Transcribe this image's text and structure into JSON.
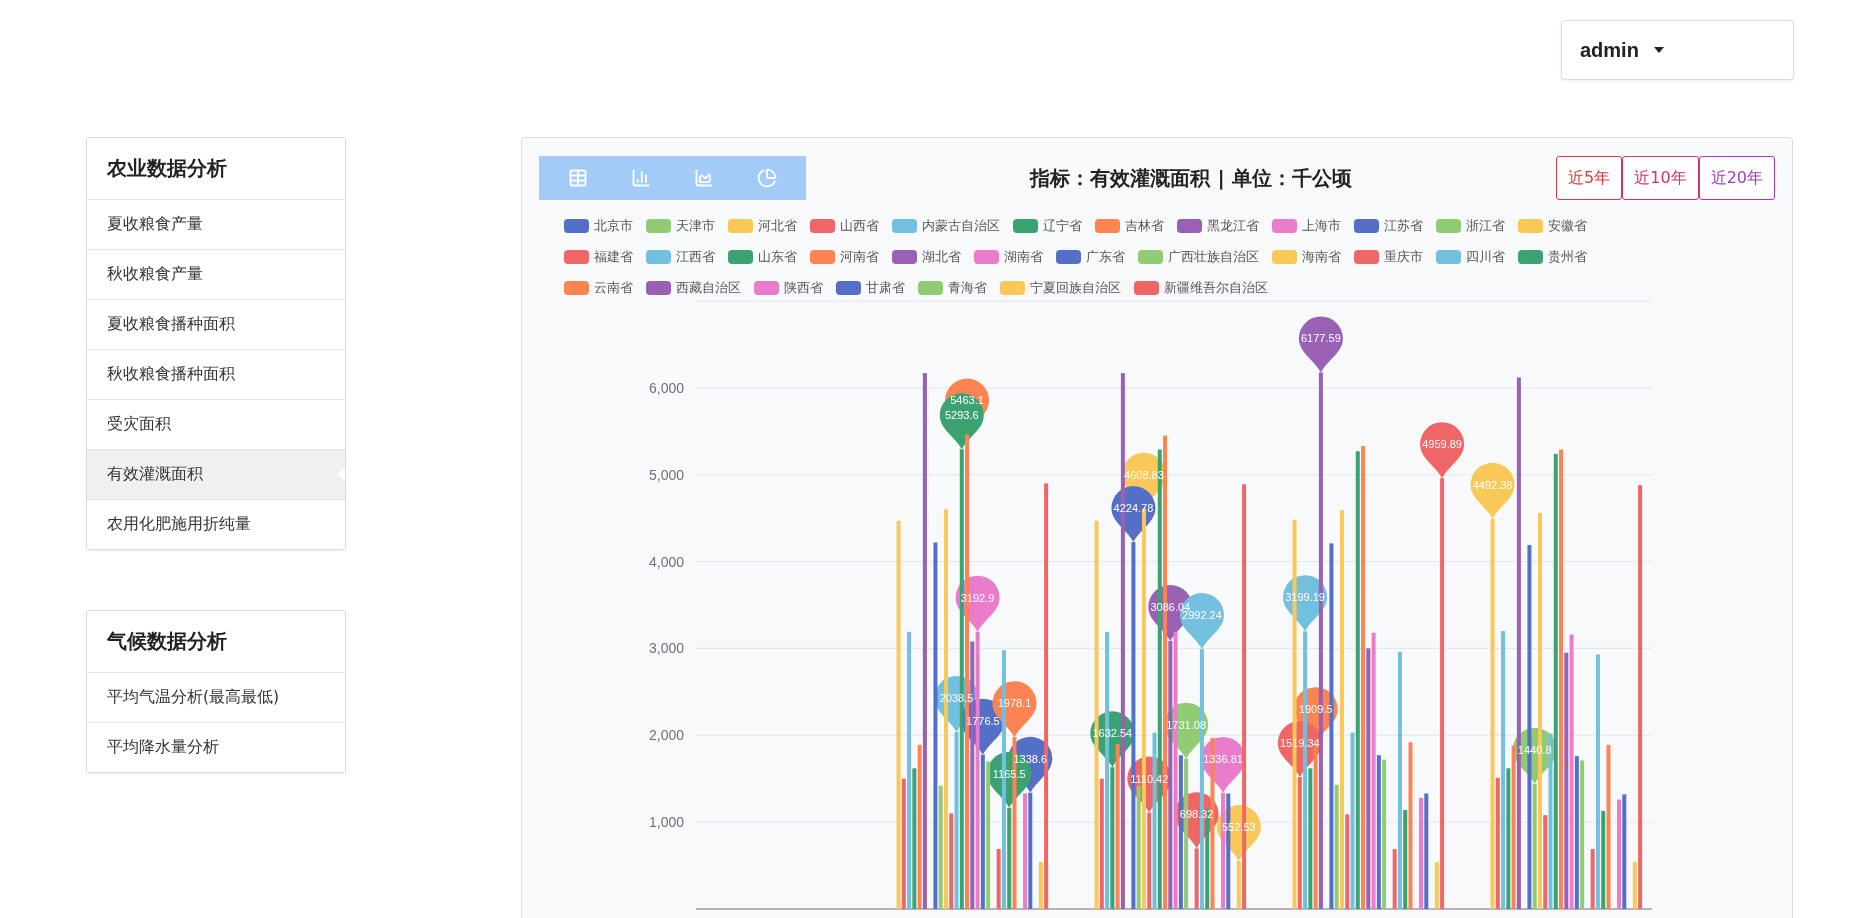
{
  "user_menu": {
    "label": "admin"
  },
  "sidebar": {
    "sections": [
      {
        "title": "农业数据分析",
        "items": [
          {
            "label": "夏收粮食产量",
            "selected": false
          },
          {
            "label": "秋收粮食产量",
            "selected": false
          },
          {
            "label": "夏收粮食播种面积",
            "selected": false
          },
          {
            "label": "秋收粮食播种面积",
            "selected": false
          },
          {
            "label": "受灾面积",
            "selected": false
          },
          {
            "label": "有效灌溉面积",
            "selected": true
          },
          {
            "label": "农用化肥施用折纯量",
            "selected": false
          }
        ]
      },
      {
        "title": "气候数据分析",
        "items": [
          {
            "label": "平均气温分析(最高最低)",
            "selected": false
          },
          {
            "label": "平均降水量分析",
            "selected": false
          }
        ]
      }
    ]
  },
  "range_buttons": [
    {
      "label": "近5年",
      "color": "#e0383e"
    },
    {
      "label": "近10年",
      "color": "#d8306a"
    },
    {
      "label": "近20年",
      "color": "#a33bc0"
    }
  ],
  "chart_data": {
    "type": "bar",
    "title": "指标：有效灌溉面积 | 单位：千公顷",
    "grid": true,
    "stacked": false,
    "ylim": [
      0,
      7000
    ],
    "yticks": [
      {
        "value": 1000,
        "label": "1,000"
      },
      {
        "value": 2000,
        "label": "2,000"
      },
      {
        "value": 3000,
        "label": "3,000"
      },
      {
        "value": 4000,
        "label": "4,000"
      },
      {
        "value": 5000,
        "label": "5,000"
      },
      {
        "value": 6000,
        "label": "6,000"
      }
    ],
    "series": [
      {
        "name": "北京市",
        "color": "#5470c6",
        "values": [
          null,
          null,
          null,
          null,
          null
        ]
      },
      {
        "name": "天津市",
        "color": "#91cc75",
        "values": [
          null,
          null,
          null,
          null,
          null
        ]
      },
      {
        "name": "河北省",
        "color": "#fac858",
        "values": [
          null,
          4470,
          4470,
          4480,
          4492.38
        ]
      },
      {
        "name": "山西省",
        "color": "#ee6666",
        "values": [
          null,
          1500,
          1500,
          1519.34,
          1510
        ]
      },
      {
        "name": "内蒙古自治区",
        "color": "#73c0de",
        "values": [
          null,
          3190,
          3190,
          3199.19,
          3200
        ]
      },
      {
        "name": "辽宁省",
        "color": "#3ba272",
        "values": [
          null,
          1620,
          1632.54,
          1620,
          1620
        ]
      },
      {
        "name": "吉林省",
        "color": "#fc8452",
        "values": [
          null,
          1890,
          1900,
          1909.5,
          1880
        ]
      },
      {
        "name": "黑龙江省",
        "color": "#9a60b4",
        "values": [
          null,
          6170,
          6170,
          6177.59,
          6120
        ]
      },
      {
        "name": "上海市",
        "color": "#ea7ccc",
        "values": [
          null,
          null,
          null,
          null,
          null
        ]
      },
      {
        "name": "江苏省",
        "color": "#5470c6",
        "values": [
          null,
          4220,
          4224.78,
          4210,
          4190
        ]
      },
      {
        "name": "浙江省",
        "color": "#91cc75",
        "values": [
          null,
          1420,
          1420,
          1430,
          1440.8
        ]
      },
      {
        "name": "安徽省",
        "color": "#fac858",
        "values": [
          null,
          4600,
          4608.83,
          4590,
          4560
        ]
      },
      {
        "name": "福建省",
        "color": "#ee6666",
        "values": [
          null,
          1100,
          1110.42,
          1090,
          1080
        ]
      },
      {
        "name": "江西省",
        "color": "#73c0de",
        "values": [
          null,
          2038.5,
          2030,
          2030,
          2020
        ]
      },
      {
        "name": "山东省",
        "color": "#3ba272",
        "values": [
          null,
          5293.6,
          5290,
          5270,
          5240
        ]
      },
      {
        "name": "河南省",
        "color": "#fc8452",
        "values": [
          null,
          5463.1,
          5450,
          5330,
          5290
        ]
      },
      {
        "name": "湖北省",
        "color": "#9a60b4",
        "values": [
          null,
          3080,
          3086.04,
          3000,
          2950
        ]
      },
      {
        "name": "湖南省",
        "color": "#ea7ccc",
        "values": [
          null,
          3192.9,
          3190,
          3180,
          3160
        ]
      },
      {
        "name": "广东省",
        "color": "#5470c6",
        "values": [
          null,
          1776.5,
          1770,
          1770,
          1760
        ]
      },
      {
        "name": "广西壮族自治区",
        "color": "#91cc75",
        "values": [
          null,
          1700,
          1731.08,
          1720,
          1710
        ]
      },
      {
        "name": "海南省",
        "color": "#fac858",
        "values": [
          null,
          null,
          null,
          null,
          null
        ]
      },
      {
        "name": "重庆市",
        "color": "#ee6666",
        "values": [
          null,
          690,
          698.32,
          690,
          690
        ]
      },
      {
        "name": "四川省",
        "color": "#73c0de",
        "values": [
          null,
          2980,
          2992.24,
          2960,
          2930
        ]
      },
      {
        "name": "贵州省",
        "color": "#3ba272",
        "values": [
          null,
          1165.5,
          1150,
          1140,
          1130
        ]
      },
      {
        "name": "云南省",
        "color": "#fc8452",
        "values": [
          null,
          1978.1,
          1970,
          1920,
          1890
        ]
      },
      {
        "name": "西藏自治区",
        "color": "#9a60b4",
        "values": [
          null,
          null,
          null,
          null,
          null
        ]
      },
      {
        "name": "陕西省",
        "color": "#ea7ccc",
        "values": [
          null,
          1330,
          1336.81,
          1280,
          1260
        ]
      },
      {
        "name": "甘肃省",
        "color": "#5470c6",
        "values": [
          null,
          1338.6,
          1330,
          1330,
          1320
        ]
      },
      {
        "name": "青海省",
        "color": "#91cc75",
        "values": [
          null,
          null,
          null,
          null,
          null
        ]
      },
      {
        "name": "宁夏回族自治区",
        "color": "#fac858",
        "values": [
          null,
          540,
          552.53,
          540,
          540
        ]
      },
      {
        "name": "新疆维吾尔自治区",
        "color": "#ee6666",
        "values": [
          null,
          4900,
          4890,
          4959.89,
          4880
        ]
      }
    ],
    "annotations": [
      {
        "text": "5463.1",
        "y": 5463.1
      },
      {
        "text": "5293.6",
        "y": 5293.6
      },
      {
        "text": "3192.9",
        "y": 3192.9
      },
      {
        "text": "2038.5",
        "y": 2038.5
      },
      {
        "text": "1776.5",
        "y": 1776.5
      },
      {
        "text": "1978.1",
        "y": 1978.1
      },
      {
        "text": "1338.6",
        "y": 1338.6
      },
      {
        "text": "1165.5",
        "y": 1165.5
      },
      {
        "text": "4608.83",
        "y": 4608.83
      },
      {
        "text": "4224.78",
        "y": 4224.78
      },
      {
        "text": "3086.04",
        "y": 3086.04
      },
      {
        "text": "2992.24",
        "y": 2992.24
      },
      {
        "text": "1632.54",
        "y": 1632.54
      },
      {
        "text": "1731.08",
        "y": 1731.08
      },
      {
        "text": "1110.42",
        "y": 1110.42
      },
      {
        "text": "1336.81",
        "y": 1336.81
      },
      {
        "text": "698.32",
        "y": 698.32
      },
      {
        "text": "552.53",
        "y": 552.53
      },
      {
        "text": "6177.59",
        "y": 6177.59
      },
      {
        "text": "4959.89",
        "y": 4959.89
      },
      {
        "text": "3199.19",
        "y": 3199.19
      },
      {
        "text": "1909.5",
        "y": 1909.5
      },
      {
        "text": "1519.34",
        "y": 1519.34
      },
      {
        "text": "4492.38",
        "y": 4492.38
      },
      {
        "text": "1440.8",
        "y": 1440.8
      }
    ]
  }
}
